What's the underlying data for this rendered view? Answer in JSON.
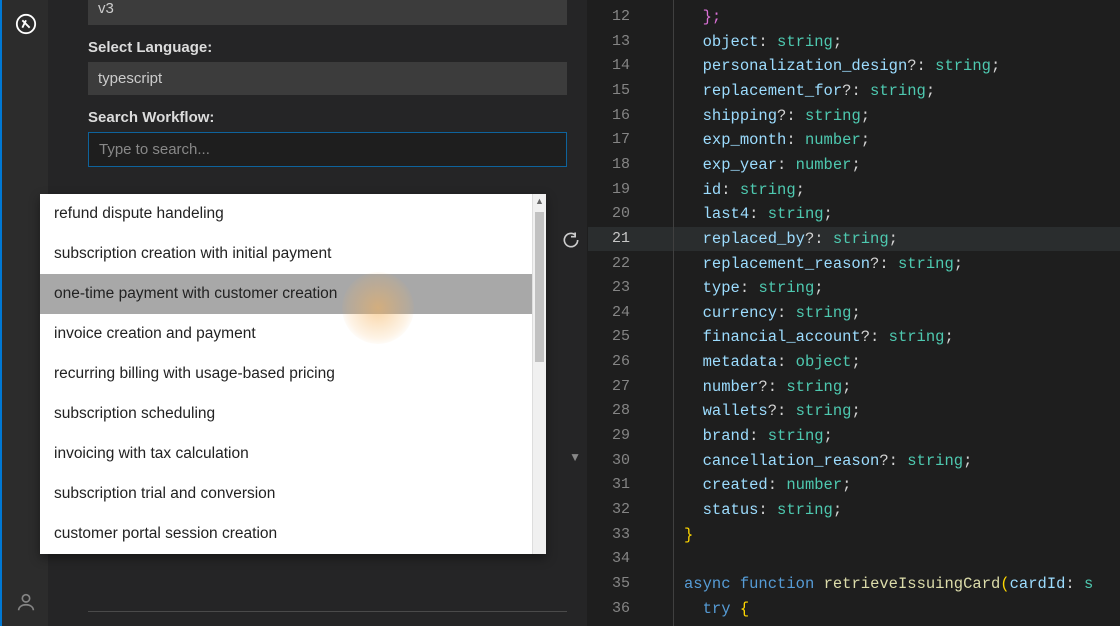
{
  "sidebar": {
    "select_language_label": "Select Language:",
    "select_language_value": "typescript",
    "version_value": "v3",
    "search_workflow_label": "Search Workflow:",
    "search_placeholder": "Type to search...",
    "search_value": ""
  },
  "dropdown": {
    "items": [
      "refund dispute handeling",
      "subscription creation with initial payment",
      "one-time payment with customer creation",
      "invoice creation and payment",
      "recurring billing with usage-based pricing",
      "subscription scheduling",
      "invoicing with tax calculation",
      "subscription trial and conversion",
      "customer portal session creation"
    ],
    "hovered_index": 2
  },
  "editor": {
    "line_start": 12,
    "active_line": 21,
    "lines": [
      {
        "n": 12,
        "tokens": [
          {
            "t": "};",
            "c": "brace",
            "indent": 1
          }
        ]
      },
      {
        "n": 13,
        "tokens": [
          {
            "t": "object",
            "c": "var",
            "indent": 1
          },
          {
            "t": ": ",
            "c": "punc"
          },
          {
            "t": "string",
            "c": "type"
          },
          {
            "t": ";",
            "c": "punc"
          }
        ]
      },
      {
        "n": 14,
        "tokens": [
          {
            "t": "personalization_design",
            "c": "var",
            "indent": 1
          },
          {
            "t": "?: ",
            "c": "punc"
          },
          {
            "t": "string",
            "c": "type"
          },
          {
            "t": ";",
            "c": "punc"
          }
        ]
      },
      {
        "n": 15,
        "tokens": [
          {
            "t": "replacement_for",
            "c": "var",
            "indent": 1
          },
          {
            "t": "?: ",
            "c": "punc"
          },
          {
            "t": "string",
            "c": "type"
          },
          {
            "t": ";",
            "c": "punc"
          }
        ]
      },
      {
        "n": 16,
        "tokens": [
          {
            "t": "shipping",
            "c": "var",
            "indent": 1
          },
          {
            "t": "?: ",
            "c": "punc"
          },
          {
            "t": "string",
            "c": "type"
          },
          {
            "t": ";",
            "c": "punc"
          }
        ]
      },
      {
        "n": 17,
        "tokens": [
          {
            "t": "exp_month",
            "c": "var",
            "indent": 1
          },
          {
            "t": ": ",
            "c": "punc"
          },
          {
            "t": "number",
            "c": "type"
          },
          {
            "t": ";",
            "c": "punc"
          }
        ]
      },
      {
        "n": 18,
        "tokens": [
          {
            "t": "exp_year",
            "c": "var",
            "indent": 1
          },
          {
            "t": ": ",
            "c": "punc"
          },
          {
            "t": "number",
            "c": "type"
          },
          {
            "t": ";",
            "c": "punc"
          }
        ]
      },
      {
        "n": 19,
        "tokens": [
          {
            "t": "id",
            "c": "var",
            "indent": 1
          },
          {
            "t": ": ",
            "c": "punc"
          },
          {
            "t": "string",
            "c": "type"
          },
          {
            "t": ";",
            "c": "punc"
          }
        ]
      },
      {
        "n": 20,
        "tokens": [
          {
            "t": "last4",
            "c": "var",
            "indent": 1
          },
          {
            "t": ": ",
            "c": "punc"
          },
          {
            "t": "string",
            "c": "type"
          },
          {
            "t": ";",
            "c": "punc"
          }
        ]
      },
      {
        "n": 21,
        "tokens": [
          {
            "t": "replaced_by",
            "c": "var",
            "indent": 1
          },
          {
            "t": "?: ",
            "c": "punc"
          },
          {
            "t": "string",
            "c": "type"
          },
          {
            "t": ";",
            "c": "punc"
          }
        ]
      },
      {
        "n": 22,
        "tokens": [
          {
            "t": "replacement_reason",
            "c": "var",
            "indent": 1
          },
          {
            "t": "?: ",
            "c": "punc"
          },
          {
            "t": "string",
            "c": "type"
          },
          {
            "t": ";",
            "c": "punc"
          }
        ]
      },
      {
        "n": 23,
        "tokens": [
          {
            "t": "type",
            "c": "var",
            "indent": 1
          },
          {
            "t": ": ",
            "c": "punc"
          },
          {
            "t": "string",
            "c": "type"
          },
          {
            "t": ";",
            "c": "punc"
          }
        ]
      },
      {
        "n": 24,
        "tokens": [
          {
            "t": "currency",
            "c": "var",
            "indent": 1
          },
          {
            "t": ": ",
            "c": "punc"
          },
          {
            "t": "string",
            "c": "type"
          },
          {
            "t": ";",
            "c": "punc"
          }
        ]
      },
      {
        "n": 25,
        "tokens": [
          {
            "t": "financial_account",
            "c": "var",
            "indent": 1
          },
          {
            "t": "?: ",
            "c": "punc"
          },
          {
            "t": "string",
            "c": "type"
          },
          {
            "t": ";",
            "c": "punc"
          }
        ]
      },
      {
        "n": 26,
        "tokens": [
          {
            "t": "metadata",
            "c": "var",
            "indent": 1
          },
          {
            "t": ": ",
            "c": "punc"
          },
          {
            "t": "object",
            "c": "type"
          },
          {
            "t": ";",
            "c": "punc"
          }
        ]
      },
      {
        "n": 27,
        "tokens": [
          {
            "t": "number",
            "c": "var",
            "indent": 1
          },
          {
            "t": "?: ",
            "c": "punc"
          },
          {
            "t": "string",
            "c": "type"
          },
          {
            "t": ";",
            "c": "punc"
          }
        ]
      },
      {
        "n": 28,
        "tokens": [
          {
            "t": "wallets",
            "c": "var",
            "indent": 1
          },
          {
            "t": "?: ",
            "c": "punc"
          },
          {
            "t": "string",
            "c": "type"
          },
          {
            "t": ";",
            "c": "punc"
          }
        ]
      },
      {
        "n": 29,
        "tokens": [
          {
            "t": "brand",
            "c": "var",
            "indent": 1
          },
          {
            "t": ": ",
            "c": "punc"
          },
          {
            "t": "string",
            "c": "type"
          },
          {
            "t": ";",
            "c": "punc"
          }
        ]
      },
      {
        "n": 30,
        "tokens": [
          {
            "t": "cancellation_reason",
            "c": "var",
            "indent": 1
          },
          {
            "t": "?: ",
            "c": "punc"
          },
          {
            "t": "string",
            "c": "type"
          },
          {
            "t": ";",
            "c": "punc"
          }
        ]
      },
      {
        "n": 31,
        "tokens": [
          {
            "t": "created",
            "c": "var",
            "indent": 1
          },
          {
            "t": ": ",
            "c": "punc"
          },
          {
            "t": "number",
            "c": "type"
          },
          {
            "t": ";",
            "c": "punc"
          }
        ]
      },
      {
        "n": 32,
        "tokens": [
          {
            "t": "status",
            "c": "var",
            "indent": 1
          },
          {
            "t": ": ",
            "c": "punc"
          },
          {
            "t": "string",
            "c": "type"
          },
          {
            "t": ";",
            "c": "punc"
          }
        ]
      },
      {
        "n": 33,
        "tokens": [
          {
            "t": "}",
            "c": "ybrace",
            "indent": 0
          }
        ]
      },
      {
        "n": 34,
        "tokens": []
      },
      {
        "n": 35,
        "tokens": [
          {
            "t": "async",
            "c": "key",
            "indent": 0
          },
          {
            "t": " ",
            "c": "punc"
          },
          {
            "t": "function",
            "c": "key"
          },
          {
            "t": " ",
            "c": "punc"
          },
          {
            "t": "retrieveIssuingCard",
            "c": "fn"
          },
          {
            "t": "(",
            "c": "ybrace"
          },
          {
            "t": "cardId",
            "c": "var"
          },
          {
            "t": ": ",
            "c": "punc"
          },
          {
            "t": "s",
            "c": "type"
          }
        ]
      },
      {
        "n": 36,
        "tokens": [
          {
            "t": "try",
            "c": "key",
            "indent": 1
          },
          {
            "t": " ",
            "c": "punc"
          },
          {
            "t": "{",
            "c": "ybrace"
          }
        ]
      }
    ]
  }
}
